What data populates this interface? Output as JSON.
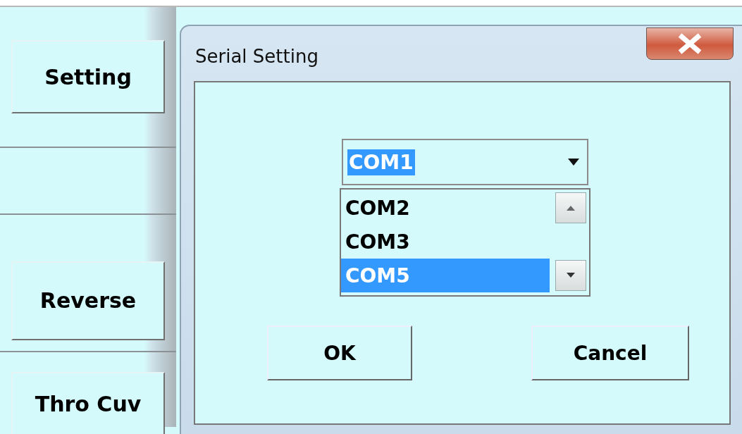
{
  "side_buttons": [
    {
      "label": "Setting"
    },
    {
      "label": "Reverse"
    },
    {
      "label": "Thro Cuv"
    }
  ],
  "dialog": {
    "title": "Serial Setting",
    "port_combo": {
      "value": "COM1",
      "highlighted": true
    },
    "port_list": [
      {
        "label": "COM2",
        "selected": false
      },
      {
        "label": "COM3",
        "selected": false
      },
      {
        "label": "COM5",
        "selected": true
      }
    ],
    "buttons": [
      {
        "label": "OK"
      },
      {
        "label": "Cancel"
      }
    ]
  }
}
